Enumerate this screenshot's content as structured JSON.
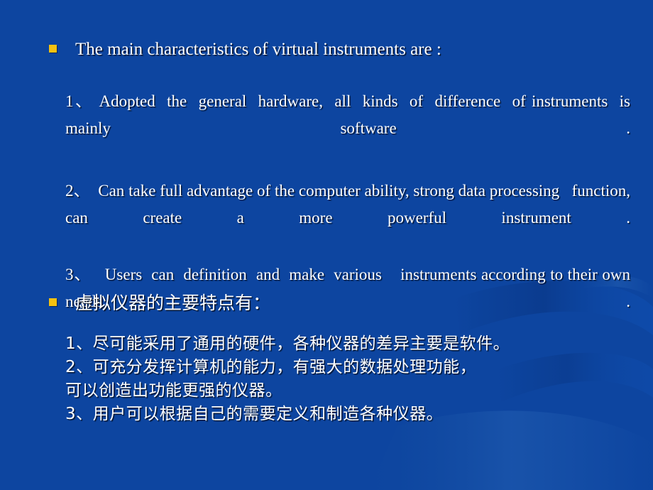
{
  "slide": {
    "background": {
      "top_color": "#000105",
      "bottom_color": "#0e47a6",
      "accent_color": "#f5c211",
      "text_color": "#ffffff"
    }
  },
  "sections": [
    {
      "id": "english",
      "bullet_label": "The main characteristics of virtual instruments are :",
      "items": [
        "1、 Adopted  the  general  hardware,  all  kinds  of  difference  of instruments  is mainly software .",
        "2、  Can take full advantage of the computer ability, strong data processing   function, can create a more powerful instrument .",
        "3、   Users  can  definition  and  make  various    instruments according to their own needs ."
      ]
    },
    {
      "id": "chinese",
      "bullet_label": "虚拟仪器的主要特点有：",
      "items": [
        "1、尽可能采用了通用的硬件，各种仪器的差异主要是软件。",
        "2、可充分发挥计算机的能力，有强大的数据处理功能，",
        "可以创造出功能更强的仪器。",
        "3、用户可以根据自己的需要定义和制造各种仪器。"
      ]
    }
  ],
  "icons": {
    "bullet_square": "filled-square-bullet"
  }
}
